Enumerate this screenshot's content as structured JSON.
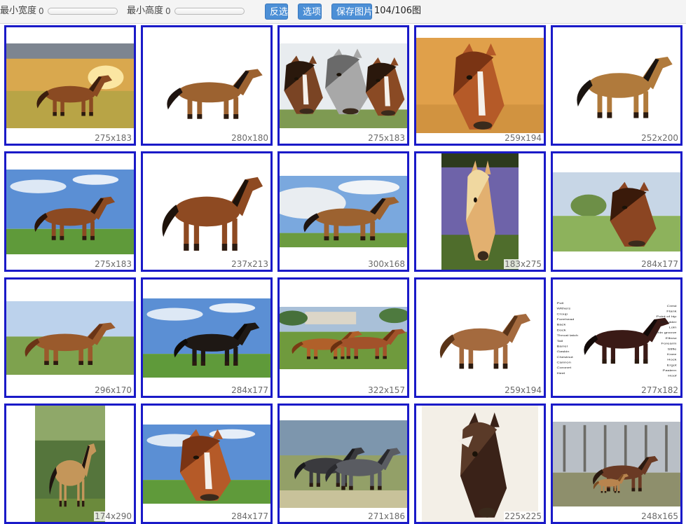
{
  "toolbar": {
    "min_width_label": "最小宽度",
    "min_width_value": "0",
    "min_height_label": "最小高度",
    "min_height_value": "0",
    "invert_button": "反选",
    "options_button": "选项",
    "save_button": "保存图片",
    "count": "104/106图"
  },
  "images": [
    {
      "dim": "275x183",
      "scene": "sunset-field",
      "horse": "brown-running"
    },
    {
      "dim": "280x180",
      "scene": "white",
      "horse": "bay-running"
    },
    {
      "dim": "275x183",
      "scene": "three-heads",
      "horse": "heads"
    },
    {
      "dim": "259x194",
      "scene": "orange",
      "horse": "chestnut-head"
    },
    {
      "dim": "252x200",
      "scene": "white",
      "horse": "buckskin-standing"
    },
    {
      "dim": "275x183",
      "scene": "blue-sky-field",
      "horse": "bay-trotting"
    },
    {
      "dim": "237x213",
      "scene": "white",
      "horse": "bay-standing"
    },
    {
      "dim": "300x168",
      "scene": "cloud-sky-field",
      "horse": "bay-running"
    },
    {
      "dim": "183x275",
      "scene": "lavender",
      "horse": "palomino-head"
    },
    {
      "dim": "284x177",
      "scene": "green-field",
      "horse": "bay-head"
    },
    {
      "dim": "296x170",
      "scene": "pasture",
      "horse": "chestnut-standing"
    },
    {
      "dim": "284x177",
      "scene": "blue-sky-field",
      "horse": "black-rearing"
    },
    {
      "dim": "322x157",
      "scene": "farm",
      "horse": "two-chestnuts"
    },
    {
      "dim": "259x194",
      "scene": "white",
      "horse": "light-bay-standing"
    },
    {
      "dim": "277x182",
      "scene": "white",
      "horse": "anatomy-diagram"
    },
    {
      "dim": "174x290",
      "scene": "forest",
      "horse": "buckskin-rearing"
    },
    {
      "dim": "284x177",
      "scene": "blue-sky-field",
      "horse": "chestnut-head"
    },
    {
      "dim": "271x186",
      "scene": "grass",
      "horse": "two-grays"
    },
    {
      "dim": "225x225",
      "scene": "cream",
      "horse": "pinto-head"
    },
    {
      "dim": "248x165",
      "scene": "winter",
      "horse": "mare-foal"
    }
  ],
  "anatomy_labels": [
    "Poll",
    "Crest",
    "Withers",
    "Flank",
    "Croup",
    "Point of hip",
    "Forehead",
    "Shoulder",
    "Back",
    "Loin",
    "Dock",
    "Chin groove",
    "Throat latch",
    "Elbow",
    "Tail",
    "Forearm",
    "Barrel",
    "Stifle",
    "Gaskin",
    "Knee",
    "Chestnut",
    "Hock",
    "Cannon",
    "Ergot",
    "Coronet",
    "Pastern",
    "Heel",
    "Hoof"
  ],
  "colors": {
    "frame_border": "#1a1ac8",
    "button_bg": "#4c8fd6",
    "toolbar_bg": "#f4f4f4"
  }
}
